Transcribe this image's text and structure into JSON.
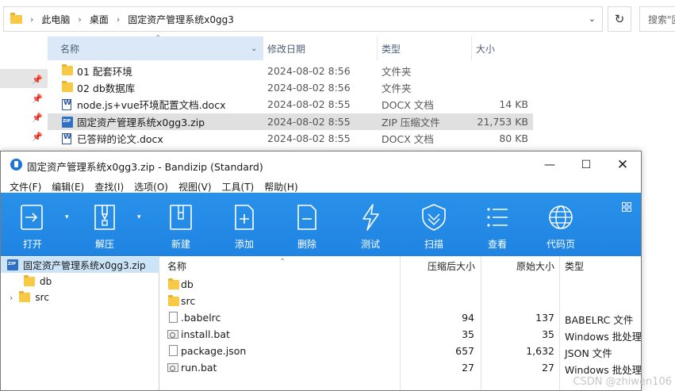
{
  "explorer": {
    "breadcrumb": [
      "此电脑",
      "桌面",
      "固定资产管理系统x0gg3"
    ],
    "search_placeholder": "搜索\"固",
    "columns": {
      "name": "名称",
      "date": "修改日期",
      "type": "类型",
      "size": "大小"
    },
    "files": [
      {
        "name": "01 配套环境",
        "date": "2024-08-02 8:56",
        "type": "文件夹",
        "size": "",
        "icon": "folder-icon"
      },
      {
        "name": "02 db数据库",
        "date": "2024-08-02 8:56",
        "type": "文件夹",
        "size": "",
        "icon": "folder-icon"
      },
      {
        "name": "node.js+vue环境配置文档.docx",
        "date": "2024-08-02 8:55",
        "type": "DOCX 文档",
        "size": "14 KB",
        "icon": "word-icon"
      },
      {
        "name": "固定资产管理系统x0gg3.zip",
        "date": "2024-08-02 8:55",
        "type": "ZIP 压缩文件",
        "size": "21,753 KB",
        "icon": "zip-icon",
        "selected": true
      },
      {
        "name": "已答辩的论文.docx",
        "date": "2024-08-02 8:55",
        "type": "DOCX 文档",
        "size": "80 KB",
        "icon": "word-icon"
      }
    ]
  },
  "bandizip": {
    "title": "固定资产管理系统x0gg3.zip - Bandizip (Standard)",
    "menu": [
      "文件(F)",
      "编辑(E)",
      "查找(I)",
      "选项(O)",
      "视图(V)",
      "工具(T)",
      "帮助(H)"
    ],
    "toolbar": [
      {
        "label": "打开",
        "icon": "open-icon"
      },
      {
        "label": "解压",
        "icon": "extract-icon"
      },
      {
        "label": "新建",
        "icon": "new-archive-icon"
      },
      {
        "label": "添加",
        "icon": "add-file-icon"
      },
      {
        "label": "删除",
        "icon": "delete-file-icon"
      },
      {
        "label": "测试",
        "icon": "test-icon"
      },
      {
        "label": "扫描",
        "icon": "scan-shield-icon"
      },
      {
        "label": "查看",
        "icon": "view-list-icon"
      },
      {
        "label": "代码页",
        "icon": "codepage-globe-icon"
      }
    ],
    "tree": [
      {
        "label": "固定资产管理系统x0gg3.zip",
        "icon": "zip-icon",
        "selected": true
      },
      {
        "label": "db",
        "icon": "folder-icon"
      },
      {
        "label": "src",
        "icon": "folder-icon",
        "expandable": true
      }
    ],
    "columns": {
      "name": "名称",
      "compressed": "压缩后大小",
      "original": "原始大小",
      "type": "类型"
    },
    "files": [
      {
        "name": "db",
        "compressed": "",
        "original": "",
        "type": "",
        "icon": "folder-icon"
      },
      {
        "name": "src",
        "compressed": "",
        "original": "",
        "type": "",
        "icon": "folder-icon"
      },
      {
        "name": ".babelrc",
        "compressed": "94",
        "original": "137",
        "type": "BABELRC 文件",
        "icon": "file-icon"
      },
      {
        "name": "install.bat",
        "compressed": "35",
        "original": "35",
        "type": "Windows 批处理文件",
        "icon": "bat-icon"
      },
      {
        "name": "package.json",
        "compressed": "657",
        "original": "1,632",
        "type": "JSON 文件",
        "icon": "file-icon"
      },
      {
        "name": "run.bat",
        "compressed": "27",
        "original": "27",
        "type": "Windows 批处理文件",
        "icon": "bat-icon"
      }
    ]
  },
  "watermark": "CSDN @zhiwen106"
}
